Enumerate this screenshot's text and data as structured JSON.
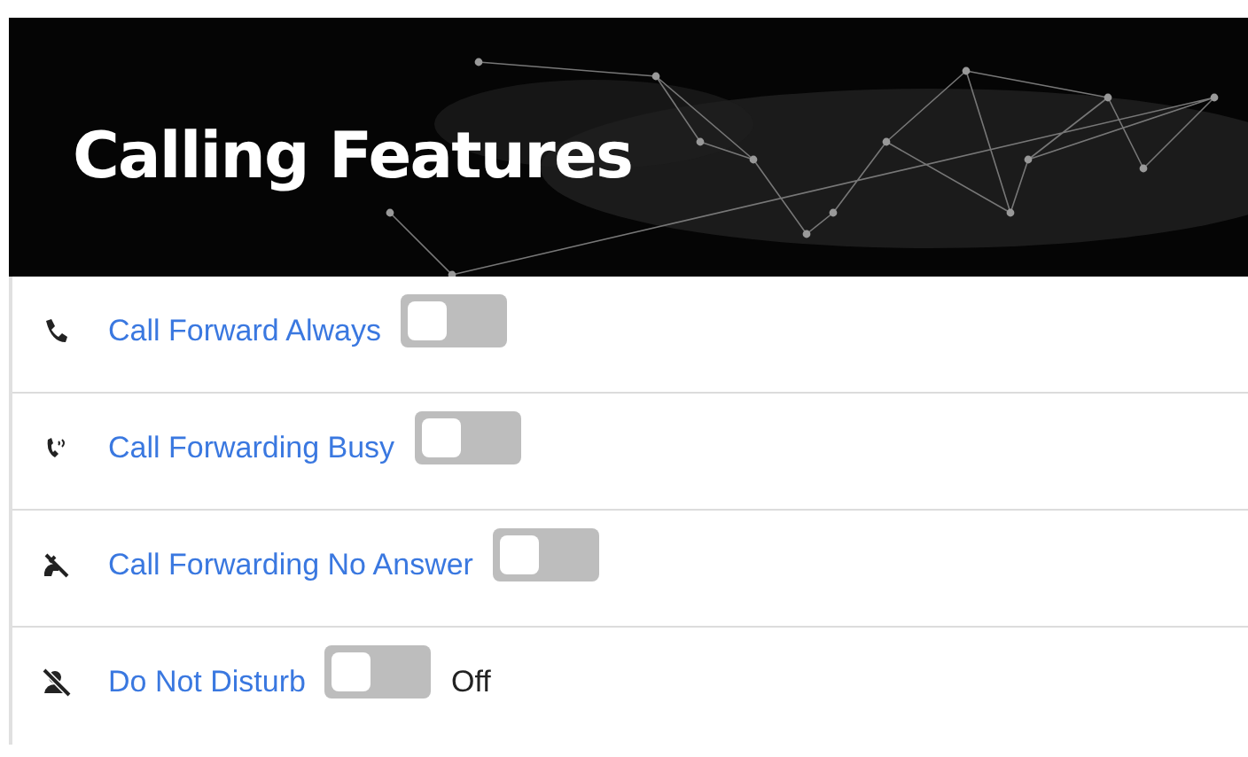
{
  "banner": {
    "title": "Calling Features"
  },
  "features": [
    {
      "label": "Call Forward Always",
      "on": false
    },
    {
      "label": "Call Forwarding Busy",
      "on": false
    },
    {
      "label": "Call Forwarding No Answer",
      "on": false
    },
    {
      "label": "Do Not Disturb",
      "on": false,
      "status": "Off"
    }
  ]
}
